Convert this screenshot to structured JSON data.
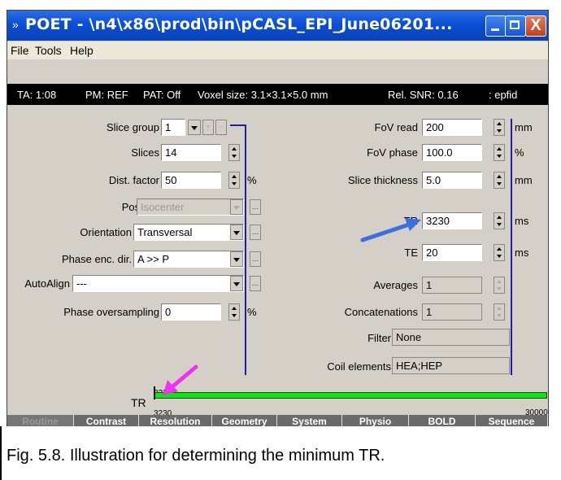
{
  "window": {
    "title": "POET - \\n4\\x86\\prod\\bin\\pCASL_EPI_June06201...",
    "minimize_label": "",
    "maximize_label": "",
    "close_label": "X"
  },
  "menu": [
    "File",
    "Tools",
    "Help"
  ],
  "status": {
    "ta": "TA: 1:08",
    "pm": "PM: REF",
    "pat": "PAT: Off",
    "voxel": "Voxel size: 3.1×3.1×5.0 mm",
    "snr": "Rel. SNR: 0.16",
    "seq": ": epfid"
  },
  "left": {
    "slice_group": {
      "label": "Slice group",
      "value": "1"
    },
    "slices": {
      "label": "Slices",
      "value": "14"
    },
    "dist_factor": {
      "label": "Dist. factor",
      "value": "50",
      "unit": "%"
    },
    "position": {
      "label": "Position",
      "value": "Isocenter",
      "dots": "..."
    },
    "orientation": {
      "label": "Orientation",
      "value": "Transversal",
      "dots": "..."
    },
    "phase_enc": {
      "label": "Phase enc. dir.",
      "value": "A >> P",
      "dots": "..."
    },
    "autoalign": {
      "label": "AutoAlign",
      "value": "---",
      "dots": "..."
    },
    "phase_os": {
      "label": "Phase oversampling",
      "value": "0",
      "unit": "%"
    }
  },
  "right": {
    "fov_read": {
      "label": "FoV read",
      "value": "200",
      "unit": "mm"
    },
    "fov_phase": {
      "label": "FoV phase",
      "value": "100.0",
      "unit": "%"
    },
    "slice_thickness": {
      "label": "Slice thickness",
      "value": "5.0",
      "unit": "mm"
    },
    "tr": {
      "label": "TR",
      "value": "3230",
      "unit": "ms"
    },
    "te": {
      "label": "TE",
      "value": "20",
      "unit": "ms"
    },
    "averages": {
      "label": "Averages",
      "value": "1"
    },
    "concatenations": {
      "label": "Concatenations",
      "value": "1"
    },
    "filter": {
      "label": "Filter",
      "value": "None"
    },
    "coil": {
      "label": "Coil elements",
      "value": "HEA;HEP"
    }
  },
  "trbar": {
    "label": "TR",
    "top_value": "3230",
    "bottom_value": "3230",
    "max_value": "30000"
  },
  "tabs": [
    "Routine",
    "Contrast",
    "Resolution",
    "Geometry",
    "System",
    "Physio",
    "BOLD",
    "Sequence"
  ],
  "active_tab": "Routine",
  "caption": "Fig. 5.8. Illustration for determining the minimum TR.",
  "colors": {
    "arrow_blue": "#3b6fe0",
    "arrow_magenta": "#ee33ee",
    "bar_green": "#00ee00",
    "line_blue": "#1e1ea8"
  }
}
